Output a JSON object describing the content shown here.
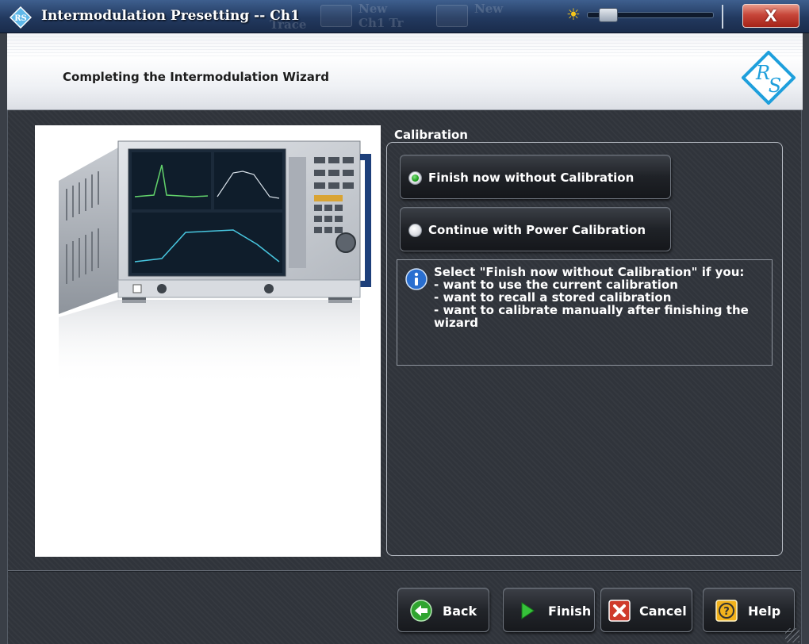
{
  "window": {
    "title": "Intermodulation Presetting -- Ch1",
    "close_label": "X",
    "background_items": [
      "New",
      "Ch1 Tr",
      "New",
      "Trace"
    ]
  },
  "header": {
    "title": "Completing the Intermodulation Wizard",
    "logo_letters": "R S"
  },
  "calibration": {
    "group_label": "Calibration",
    "options": [
      {
        "label": "Finish now without Calibration",
        "selected": true
      },
      {
        "label": "Continue with Power Calibration",
        "selected": false
      }
    ],
    "info_text": "Select \"Finish now without Calibration\" if you:\n- want to use the current calibration\n- want to recall a stored calibration\n- want to calibrate manually after finishing the wizard"
  },
  "buttons": {
    "back": "Back",
    "finish": "Finish",
    "cancel": "Cancel",
    "help": "Help"
  },
  "colors": {
    "title_bar": "#22395f",
    "close_button": "#c7463a",
    "radio_selected": "#1fa01f",
    "brand_blue": "#1e9fdc"
  },
  "icons": {
    "back": "arrow-left-circle-icon",
    "finish": "play-triangle-icon",
    "cancel": "x-box-icon",
    "help": "question-bubble-icon",
    "info": "info-circle-icon"
  }
}
